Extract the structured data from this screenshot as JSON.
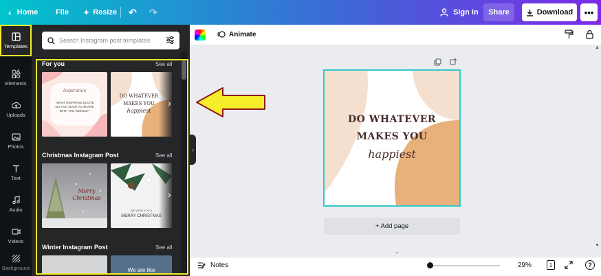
{
  "topbar": {
    "home_label": "Home",
    "file_label": "File",
    "resize_label": "Resize",
    "signin_label": "Sign in",
    "share_label": "Share",
    "download_label": "Download",
    "more_label": "•••"
  },
  "rail": {
    "items": [
      {
        "label": "Templates",
        "icon": "templates-icon",
        "active": true
      },
      {
        "label": "Elements",
        "icon": "shapes-icon"
      },
      {
        "label": "Uploads",
        "icon": "upload-icon"
      },
      {
        "label": "Photos",
        "icon": "image-icon"
      },
      {
        "label": "Text",
        "icon": "text-icon"
      },
      {
        "label": "Audio",
        "icon": "music-icon"
      },
      {
        "label": "Videos",
        "icon": "video-icon"
      },
      {
        "label": "Background",
        "icon": "pattern-icon"
      }
    ]
  },
  "panel": {
    "search_placeholder": "Search Instagram post templates",
    "sections": [
      {
        "title": "For you",
        "see_all": "See all",
        "thumbs": [
          {
            "text": "\"WHAT INSPIRING QUOTE DO YOU WANT TO SHARE WITH THE WORLD?\"",
            "script": "Inspiration"
          },
          {
            "text": "DO WHATEVER MAKES YOU",
            "script": "happiest"
          }
        ]
      },
      {
        "title": "Christmas Instagram Post",
        "see_all": "See all",
        "thumbs": [
          {
            "script": "Merry Christmas"
          },
          {
            "text": "MERRY CHRISTMAS",
            "small": "WE WISH YOU A"
          }
        ]
      },
      {
        "title": "Winter Instagram Post",
        "see_all": "See all",
        "thumbs": [
          {
            "text": ""
          },
          {
            "text": "We are like"
          }
        ]
      }
    ]
  },
  "editor": {
    "animate_label": "Animate",
    "design_line1": "DO WHATEVER",
    "design_line2": "MAKES YOU",
    "design_script": "happiest",
    "add_page_label": "+ Add page"
  },
  "footer": {
    "notes_label": "Notes",
    "zoom_value": "29%",
    "page_count": "1",
    "zoom_fraction": 0.02
  },
  "colors": {
    "highlight": "#f7ee2a",
    "arrow_fill": "#f7ee2a",
    "arrow_stroke": "#8b1a1a",
    "peach": "#f5e0cf",
    "tan": "#e8b07a"
  }
}
